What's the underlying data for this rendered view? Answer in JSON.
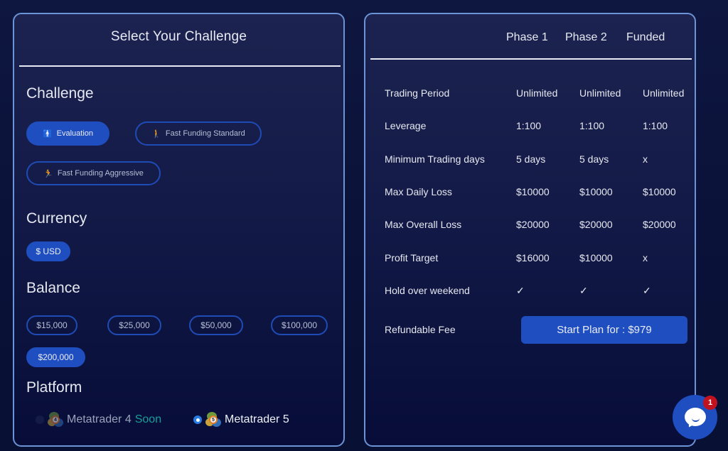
{
  "left_panel": {
    "title": "Select Your Challenge",
    "challenge": {
      "heading": "Challenge",
      "options": [
        {
          "label": "Evaluation",
          "icon": "person-standing-icon",
          "glyph": "🚹",
          "selected": true
        },
        {
          "label": "Fast Funding Standard",
          "icon": "person-walking-icon",
          "glyph": "🚶",
          "selected": false
        },
        {
          "label": "Fast Funding Aggressive",
          "icon": "person-running-icon",
          "glyph": "🏃",
          "selected": false
        }
      ]
    },
    "currency": {
      "heading": "Currency",
      "options": [
        {
          "label": "$ USD",
          "selected": true
        }
      ]
    },
    "balance": {
      "heading": "Balance",
      "options": [
        {
          "label": "$15,000",
          "selected": false
        },
        {
          "label": "$25,000",
          "selected": false
        },
        {
          "label": "$50,000",
          "selected": false
        },
        {
          "label": "$100,000",
          "selected": false
        },
        {
          "label": "$200,000",
          "selected": true
        }
      ]
    },
    "platform": {
      "heading": "Platform",
      "options": [
        {
          "label": "Metatrader 4",
          "badge": "Soon",
          "logo_number": "4",
          "selected": false,
          "disabled": true
        },
        {
          "label": "Metatrader 5",
          "logo_number": "5",
          "selected": true,
          "disabled": false
        }
      ]
    }
  },
  "right_panel": {
    "columns": [
      "Phase 1",
      "Phase 2",
      "Funded"
    ],
    "rows": [
      {
        "label": "Trading Period",
        "values": [
          "Unlimited",
          "Unlimited",
          "Unlimited"
        ]
      },
      {
        "label": "Leverage",
        "values": [
          "1:100",
          "1:100",
          "1:100"
        ]
      },
      {
        "label": "Minimum Trading days",
        "values": [
          "5 days",
          "5 days",
          "x"
        ]
      },
      {
        "label": "Max Daily Loss",
        "values": [
          "$10000",
          "$10000",
          "$10000"
        ]
      },
      {
        "label": "Max Overall Loss",
        "values": [
          "$20000",
          "$20000",
          "$20000"
        ]
      },
      {
        "label": "Profit Target",
        "values": [
          "$16000",
          "$10000",
          "x"
        ]
      },
      {
        "label": "Hold over weekend",
        "values": [
          "✓",
          "✓",
          "✓"
        ]
      }
    ],
    "fee_label": "Refundable Fee",
    "start_button": "Start Plan for : $979"
  },
  "chat_widget": {
    "icon": "chat-bubble-icon",
    "unread_count": "1"
  },
  "colors": {
    "accent": "#1f4ec0",
    "panel_border": "#6b93d6",
    "soon": "#1a9e9a",
    "badge": "#c1121f"
  }
}
